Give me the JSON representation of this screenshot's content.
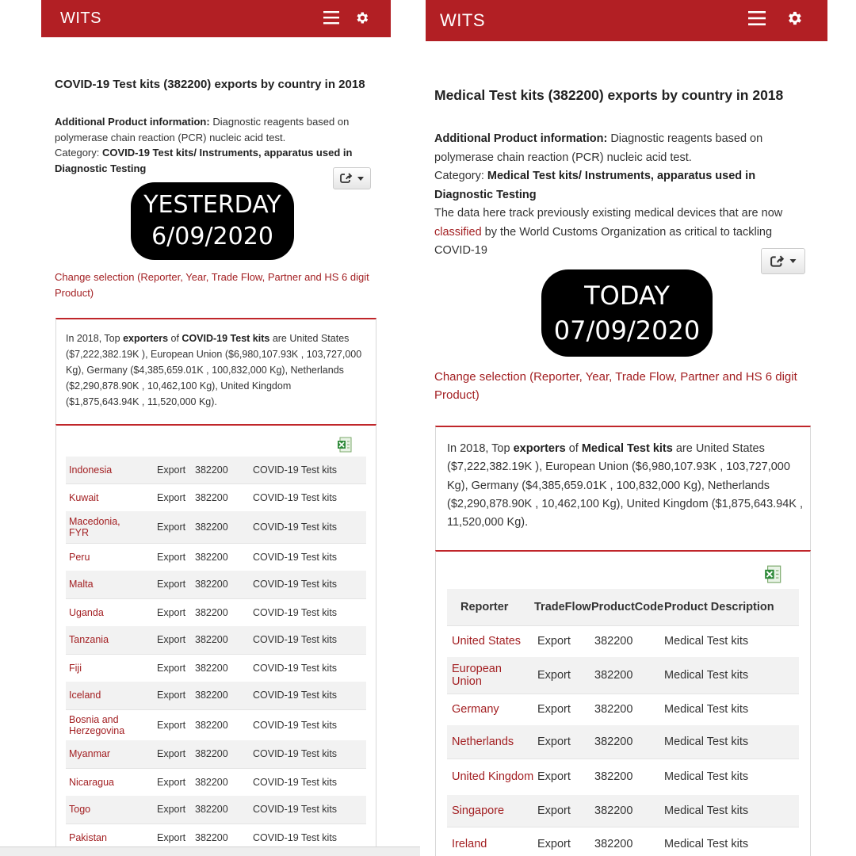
{
  "colors": {
    "brand": "#b21f24",
    "link": "#a32023",
    "accent_line": "#c0262a",
    "stamp_bg": "#000000"
  },
  "icons": {
    "menu": "hamburger-icon",
    "settings": "gear-icon",
    "share": "share-icon",
    "caret": "caret-down-icon",
    "excel": "excel-icon"
  },
  "left": {
    "app_name": "WITS",
    "title": "COVID-19 Test kits (382200) exports by country in 2018",
    "info_label": "Additional Product information:",
    "info_text": " Diagnostic reagents based on polymerase chain reaction (PCR) nucleic acid test.",
    "category_label": "Category:",
    "category_text": " COVID-19 Test kits/ Instruments, apparatus used in Diagnostic Testing",
    "stamp": {
      "line1": "YESTERDAY",
      "line2": "6/09/2020"
    },
    "change_link": "Change selection (Reporter, Year, Trade Flow, Partner and HS 6 digit Product)",
    "summary": {
      "prefix": "In 2018, Top ",
      "exporters": "exporters",
      "of": " of ",
      "product": "COVID-19 Test kits",
      "rest": " are United States ($7,222,382.19K ), European Union ($6,980,107.93K , 103,727,000 Kg), Germany ($4,385,659.01K , 100,832,000 Kg), Netherlands ($2,290,878.90K , 10,462,100 Kg), United Kingdom ($1,875,643.94K , 11,520,000 Kg)."
    },
    "rows": [
      [
        "Indonesia",
        "Export",
        "382200",
        "COVID-19 Test kits"
      ],
      [
        "Kuwait",
        "Export",
        "382200",
        "COVID-19 Test kits"
      ],
      [
        "Macedonia, FYR",
        "Export",
        "382200",
        "COVID-19 Test kits"
      ],
      [
        "Peru",
        "Export",
        "382200",
        "COVID-19 Test kits"
      ],
      [
        "Malta",
        "Export",
        "382200",
        "COVID-19 Test kits"
      ],
      [
        "Uganda",
        "Export",
        "382200",
        "COVID-19 Test kits"
      ],
      [
        "Tanzania",
        "Export",
        "382200",
        "COVID-19 Test kits"
      ],
      [
        "Fiji",
        "Export",
        "382200",
        "COVID-19 Test kits"
      ],
      [
        "Iceland",
        "Export",
        "382200",
        "COVID-19 Test kits"
      ],
      [
        "Bosnia and Herzegovina",
        "Export",
        "382200",
        "COVID-19 Test kits"
      ],
      [
        "Myanmar",
        "Export",
        "382200",
        "COVID-19 Test kits"
      ],
      [
        "Nicaragua",
        "Export",
        "382200",
        "COVID-19 Test kits"
      ],
      [
        "Togo",
        "Export",
        "382200",
        "COVID-19 Test kits"
      ],
      [
        "Pakistan",
        "Export",
        "382200",
        "COVID-19 Test kits"
      ]
    ]
  },
  "right": {
    "app_name": "WITS",
    "title": "Medical Test kits (382200) exports by country in 2018",
    "info_label": "Additional Product information:",
    "info_text": " Diagnostic reagents based on polymerase chain reaction (PCR) nucleic acid test.",
    "category_label": "Category:",
    "category_text": " Medical Test kits/ Instruments, apparatus used in Diagnostic Testing",
    "note_before": "The data here track previously existing medical devices that are now ",
    "note_link": "classified",
    "note_after": " by the World Customs Organization as critical to tackling COVID-19",
    "stamp": {
      "line1": "TODAY",
      "line2": "07/09/2020"
    },
    "change_link": "Change selection (Reporter, Year, Trade Flow, Partner and HS 6 digit Product)",
    "summary": {
      "prefix": "In 2018, Top ",
      "exporters": "exporters",
      "of": " of ",
      "product": "Medical Test kits",
      "rest": " are United States ($7,222,382.19K ), European Union ($6,980,107.93K , 103,727,000 Kg), Germany ($4,385,659.01K , 100,832,000 Kg), Netherlands ($2,290,878.90K , 10,462,100 Kg), United Kingdom ($1,875,643.94K , 11,520,000 Kg)."
    },
    "columns": [
      "Reporter",
      "TradeFlow",
      "ProductCode",
      "Product Description"
    ],
    "rows": [
      [
        "United States",
        "Export",
        "382200",
        "Medical Test kits"
      ],
      [
        "European Union",
        "Export",
        "382200",
        "Medical Test kits"
      ],
      [
        "Germany",
        "Export",
        "382200",
        "Medical Test kits"
      ],
      [
        "Netherlands",
        "Export",
        "382200",
        "Medical Test kits"
      ],
      [
        "United Kingdom",
        "Export",
        "382200",
        "Medical Test kits"
      ],
      [
        "Singapore",
        "Export",
        "382200",
        "Medical Test kits"
      ],
      [
        "Ireland",
        "Export",
        "382200",
        "Medical Test kits"
      ]
    ]
  }
}
